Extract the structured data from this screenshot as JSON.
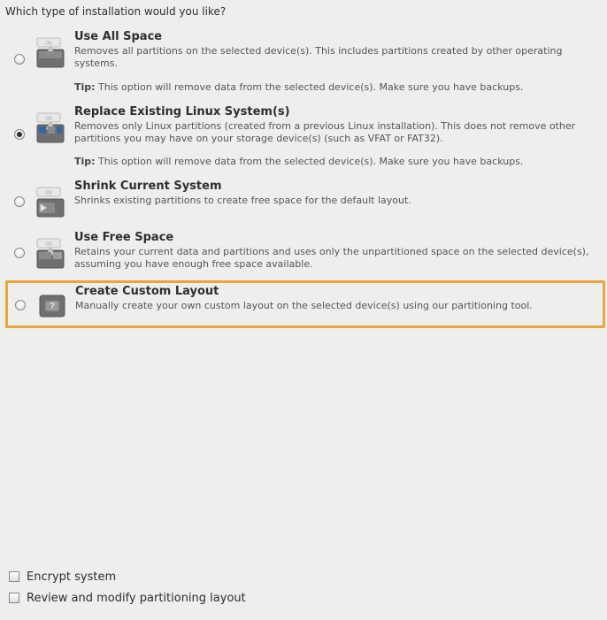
{
  "question": "Which type of installation would you like?",
  "options": [
    {
      "id": "use-all-space",
      "title": "Use All Space",
      "desc": "Removes all partitions on the selected device(s).  This includes partitions created by other operating systems.",
      "tip_label": "Tip:",
      "tip": "This option will remove data from the selected device(s).  Make sure you have backups.",
      "selected": false,
      "icon": "disk-all"
    },
    {
      "id": "replace-linux",
      "title": "Replace Existing Linux System(s)",
      "desc": "Removes only Linux partitions (created from a previous Linux installation).  This does not remove other partitions you may have on your storage device(s) (such as VFAT or FAT32).",
      "tip_label": "Tip:",
      "tip": "This option will remove data from the selected device(s).  Make sure you have backups.",
      "selected": true,
      "icon": "disk-replace"
    },
    {
      "id": "shrink-current",
      "title": "Shrink Current System",
      "desc": "Shrinks existing partitions to create free space for the default layout.",
      "tip_label": "",
      "tip": "",
      "selected": false,
      "icon": "disk-shrink"
    },
    {
      "id": "use-free-space",
      "title": "Use Free Space",
      "desc": "Retains your current data and partitions and uses only the unpartitioned space on the selected device(s), assuming you have enough free space available.",
      "tip_label": "",
      "tip": "",
      "selected": false,
      "icon": "disk-free"
    },
    {
      "id": "custom-layout",
      "title": "Create Custom Layout",
      "desc": "Manually create your own custom layout on the selected device(s) using our partitioning tool.",
      "tip_label": "",
      "tip": "",
      "selected": false,
      "icon": "disk-custom",
      "highlighted": true
    }
  ],
  "checks": {
    "encrypt_label": "Encrypt system",
    "review_label": "Review and modify partitioning layout"
  }
}
